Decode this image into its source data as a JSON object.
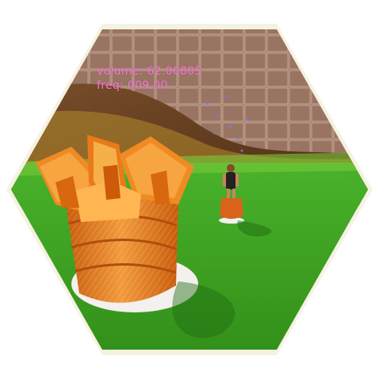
{
  "hud": {
    "volume_label": "volume:",
    "volume_value": "62.00805",
    "freq_label": "freq:",
    "freq_value": "009.00"
  },
  "colors": {
    "hud_text": "#f07ad8",
    "frame_outline": "#f3efdc",
    "grass": "#3a9b1e",
    "wall": "#9a7562",
    "drum": "#e3771c"
  },
  "scene": {
    "objects": [
      "wall-texture",
      "ramp",
      "grass-field",
      "large-drum-with-crown",
      "character-on-drum",
      "small-drum",
      "particle-sparkles"
    ]
  }
}
